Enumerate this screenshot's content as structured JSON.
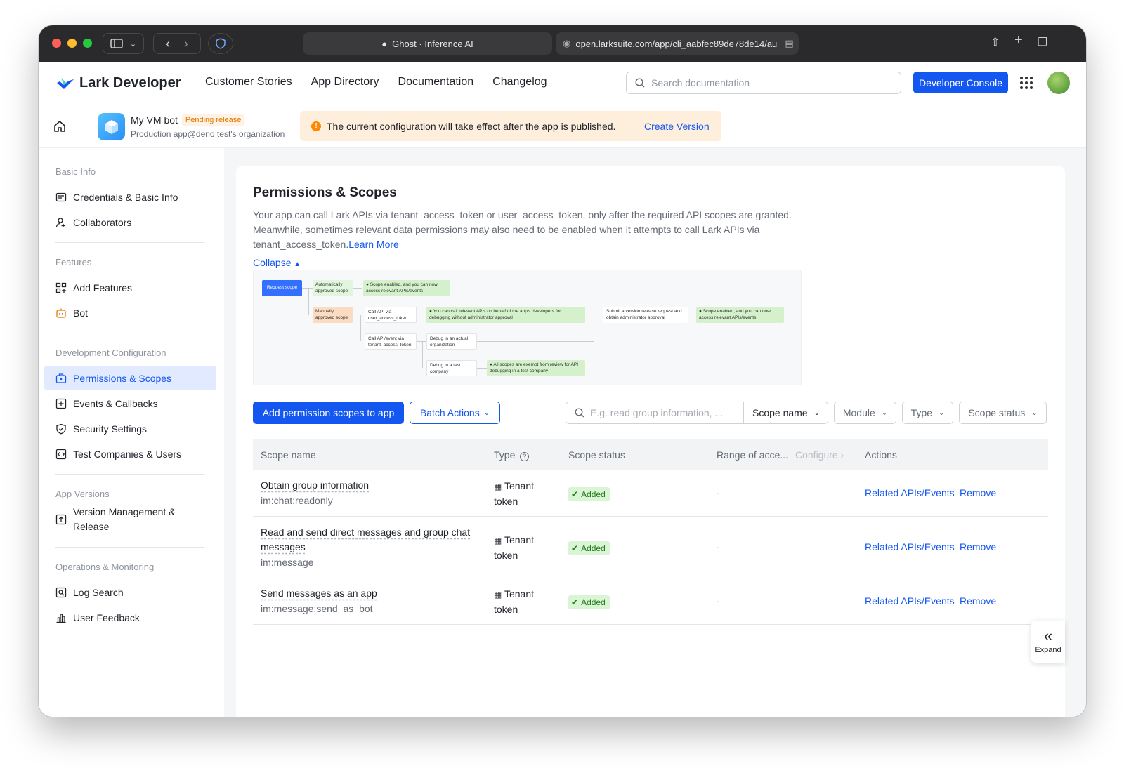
{
  "browser": {
    "tab_title": "Ghost · Inference AI",
    "url": "open.larksuite.com/app/cli_aabfec89de78de14/au"
  },
  "topnav": {
    "logo": "Lark Developer",
    "links": [
      "Customer Stories",
      "App Directory",
      "Documentation",
      "Changelog"
    ],
    "search_placeholder": "Search documentation",
    "console_label": "Developer Console"
  },
  "appbar": {
    "app_name": "My VM bot",
    "status": "Pending release",
    "subtitle": "Production app@deno test's organization",
    "notice": "The current configuration will take effect after the app is published.",
    "notice_action": "Create Version"
  },
  "sidebar": {
    "groups": [
      {
        "title": "Basic Info",
        "items": [
          {
            "label": "Credentials & Basic Info",
            "icon": "id-card-icon"
          },
          {
            "label": "Collaborators",
            "icon": "user-add-icon"
          }
        ]
      },
      {
        "title": "Features",
        "items": [
          {
            "label": "Add Features",
            "icon": "grid-plus-icon"
          },
          {
            "label": "Bot",
            "icon": "bot-icon"
          }
        ]
      },
      {
        "title": "Development Configuration",
        "items": [
          {
            "label": "Permissions & Scopes",
            "icon": "briefcase-icon"
          },
          {
            "label": "Events & Callbacks",
            "icon": "plus-box-icon"
          },
          {
            "label": "Security Settings",
            "icon": "shield-icon"
          },
          {
            "label": "Test Companies & Users",
            "icon": "code-icon"
          }
        ]
      },
      {
        "title": "App Versions",
        "items": [
          {
            "label": "Version Management & Release",
            "icon": "upload-icon"
          }
        ]
      },
      {
        "title": "Operations & Monitoring",
        "items": [
          {
            "label": "Log Search",
            "icon": "log-search-icon"
          },
          {
            "label": "User Feedback",
            "icon": "bar-chart-icon"
          }
        ]
      }
    ],
    "active": "Permissions & Scopes"
  },
  "main": {
    "title": "Permissions & Scopes",
    "description": "Your app can call Lark APIs via tenant_access_token or user_access_token, only after the required API scopes are granted. Meanwhile, sometimes relevant data permissions may also need to be enabled when it attempts to call Lark APIs via tenant_access_token.",
    "learn_more": "Learn More",
    "collapse": "Collapse",
    "flow": {
      "request_scope": "Request scope",
      "auto": "Automatically approved scope",
      "auto_result": "Scope enabled, and you can now access relevant APIs/events",
      "manual": "Manually approved scope",
      "call_user": "Call API via user_access_token",
      "call_user_result": "You can call relevant APIs on behalf of the app's developers for debugging without administrator approval",
      "submit": "Submit a version release request and obtain administrator approval",
      "final": "Scope enabled, and you can now access relevant APIs/events",
      "call_tenant": "Call API/event via tenant_access_token",
      "debug_actual": "Debug in an actual organization",
      "debug_test": "Debug in a test company",
      "exempt": "All scopes are exempt from review for API debugging in a test company"
    },
    "add_button": "Add permission scopes to app",
    "batch_button": "Batch Actions",
    "search_placeholder": "E.g. read group information, ...",
    "search_field": "Scope name",
    "filters": [
      "Module",
      "Type",
      "Scope status"
    ],
    "columns": {
      "name": "Scope name",
      "type": "Type",
      "status": "Scope status",
      "range": "Range of acce...",
      "configure": "Configure",
      "actions": "Actions"
    },
    "rows": [
      {
        "name": "Obtain group information",
        "code": "im:chat:readonly",
        "type": "Tenant token",
        "status": "Added",
        "range": "-",
        "related": "Related APIs/Events",
        "remove": "Remove"
      },
      {
        "name": "Read and send direct messages and group chat messages",
        "code": "im:message",
        "type": "Tenant token",
        "status": "Added",
        "range": "-",
        "related": "Related APIs/Events",
        "remove": "Remove"
      },
      {
        "name": "Send messages as an app",
        "code": "im:message:send_as_bot",
        "type": "Tenant token",
        "status": "Added",
        "range": "-",
        "related": "Related APIs/Events",
        "remove": "Remove"
      }
    ],
    "expand_label": "Expand"
  },
  "colors": {
    "accent": "#1456f0",
    "added_bg": "#d9f5d6",
    "added_fg": "#237b19",
    "notice_bg": "#feefdd",
    "pending_fg": "#de7802"
  }
}
